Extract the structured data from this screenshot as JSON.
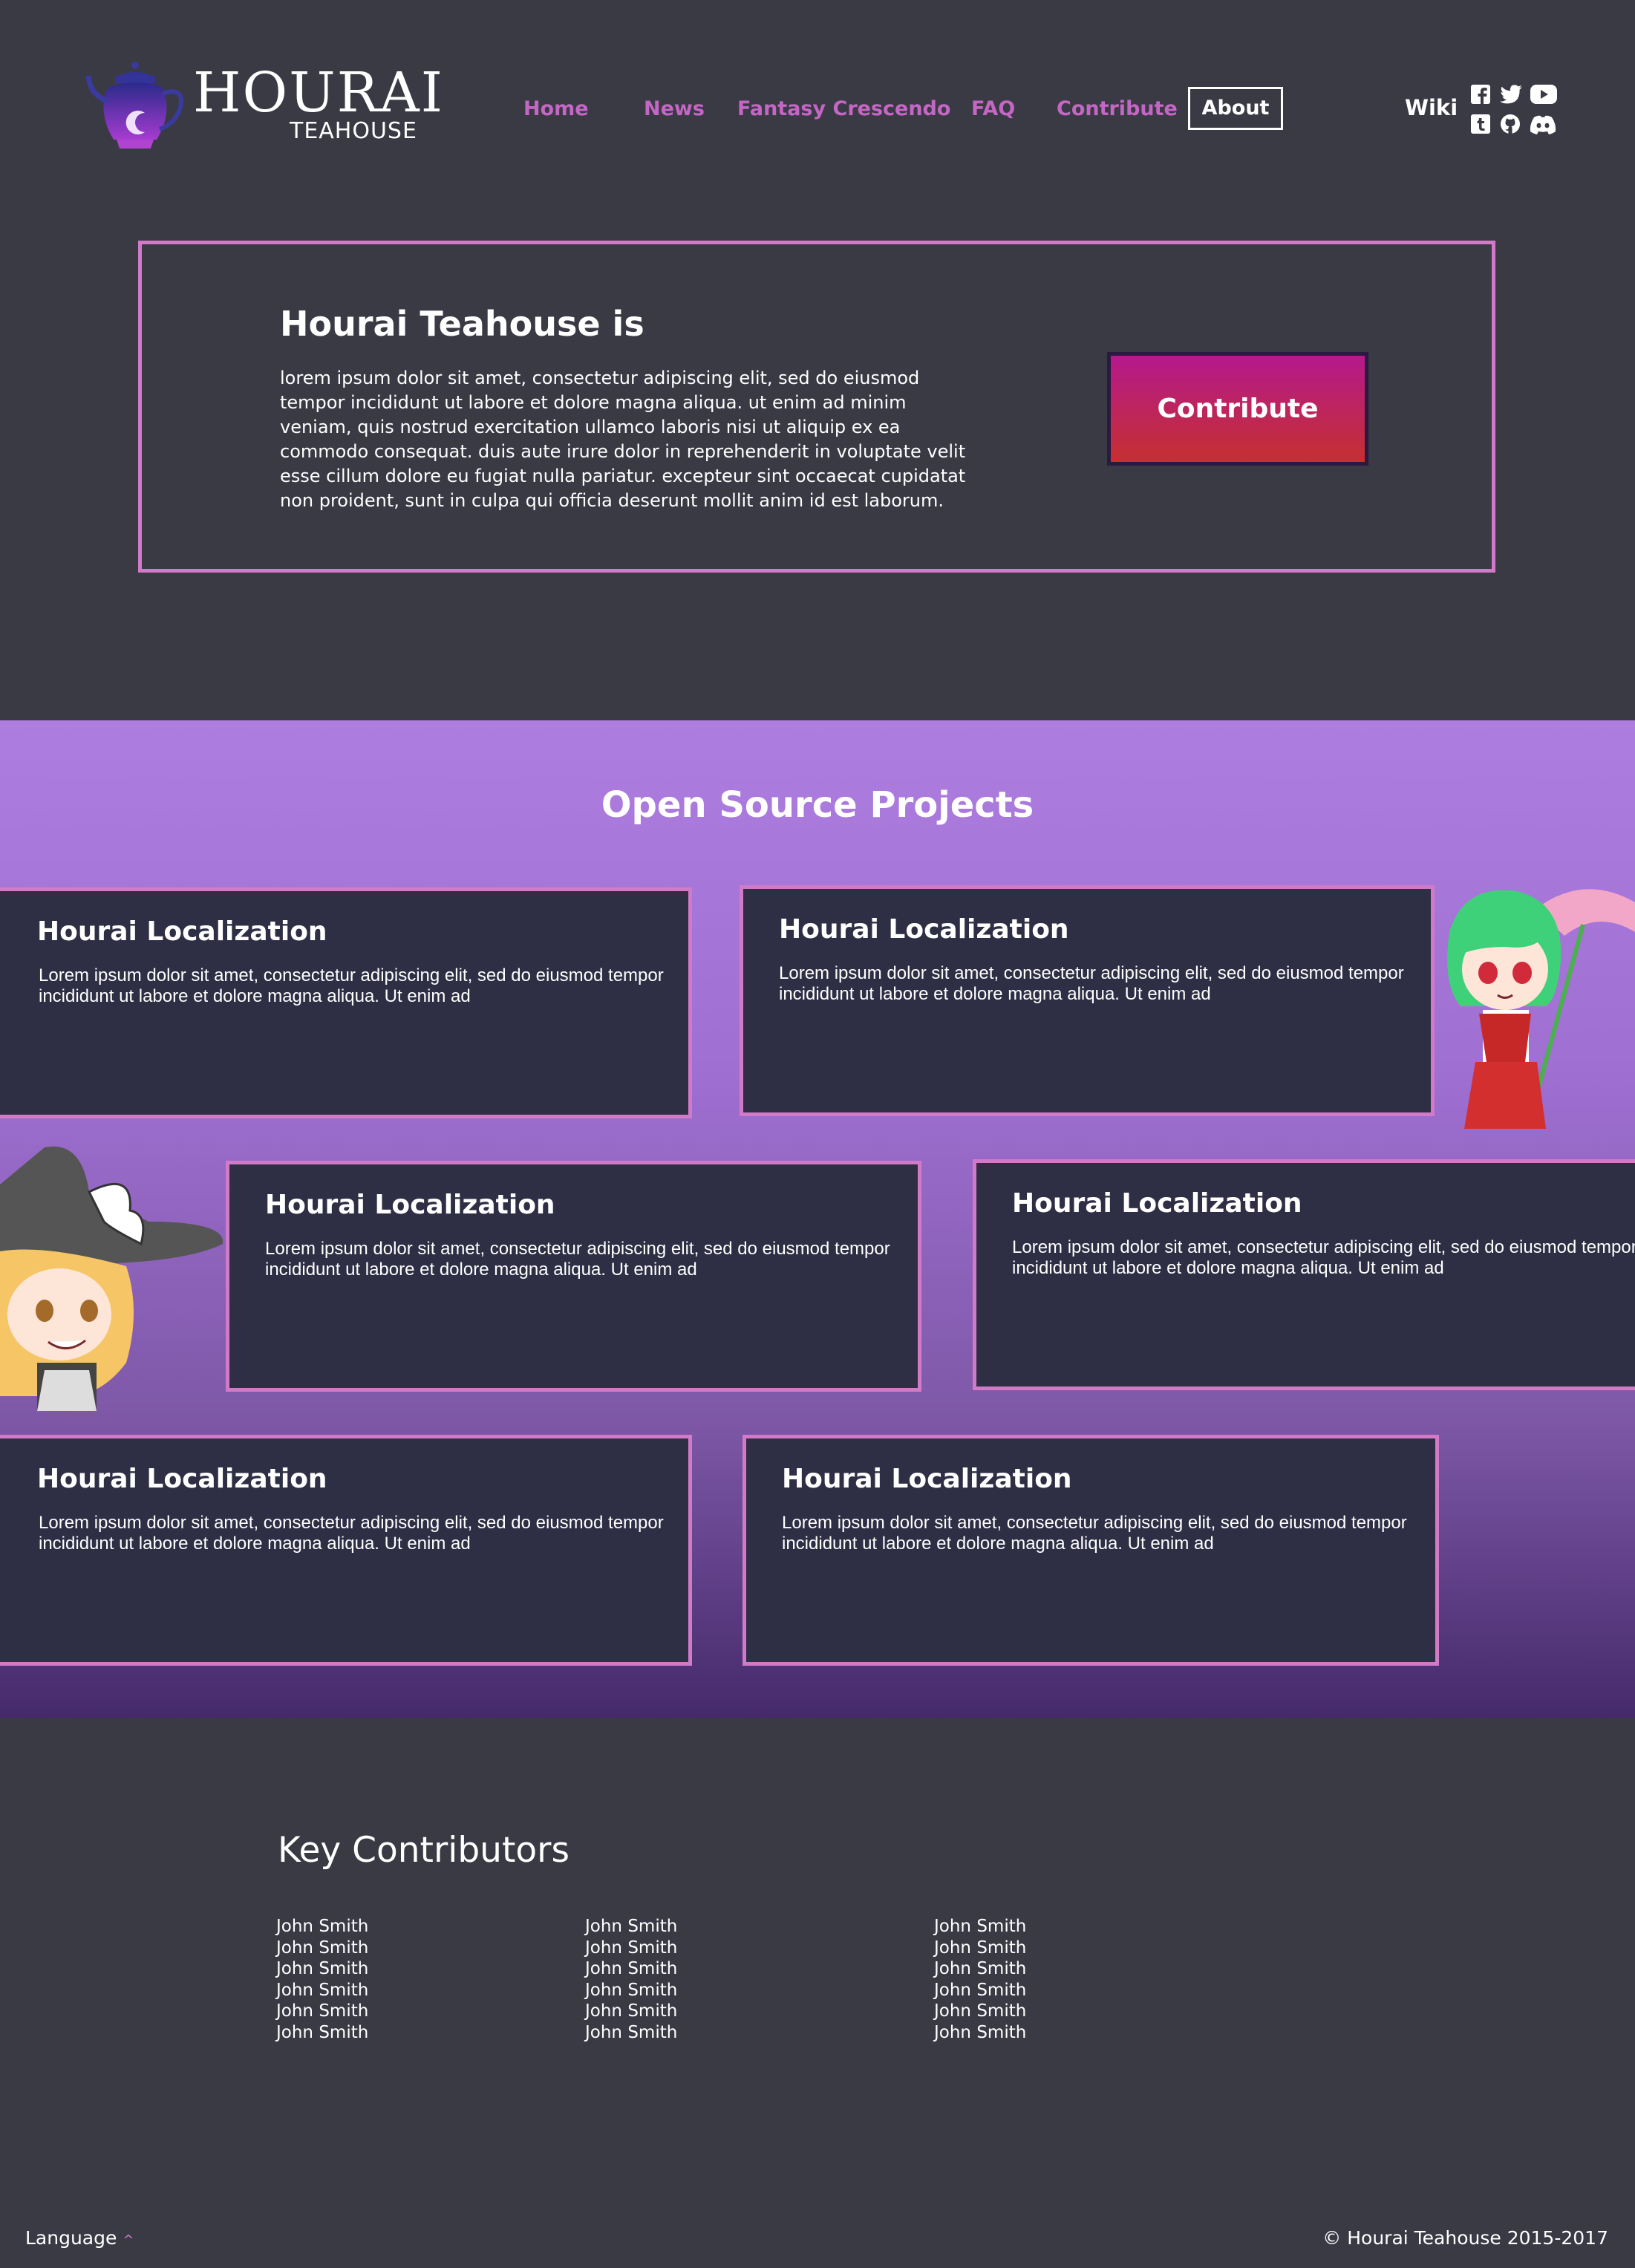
{
  "header": {
    "logo_title": "HOURAI",
    "logo_sub": "TEAHOUSE",
    "nav": [
      {
        "label": "Home"
      },
      {
        "label": "News"
      },
      {
        "label": "Fantasy Crescendo"
      },
      {
        "label": "FAQ"
      },
      {
        "label": "Contribute"
      },
      {
        "label": "About"
      }
    ],
    "wiki_label": "Wiki",
    "social_icons": [
      "facebook-icon",
      "twitter-icon",
      "youtube-icon",
      "tumblr-icon",
      "github-icon",
      "discord-icon"
    ]
  },
  "intro": {
    "heading": "Hourai Teahouse is",
    "text": "lorem ipsum dolor sit amet, consectetur adipiscing elit, sed do eiusmod tempor incididunt ut labore et dolore magna aliqua. ut enim ad minim veniam, quis nostrud exercitation ullamco laboris nisi ut aliquip ex ea commodo consequat. duis aute irure dolor in reprehenderit in voluptate velit esse cillum dolore eu fugiat nulla pariatur. excepteur sint occaecat cupidatat non proident, sunt in culpa qui officia deserunt mollit anim id est laborum.",
    "button_label": "Contribute"
  },
  "projects": {
    "title": "Open Source Projects",
    "cards": [
      {
        "title": "Hourai Localization",
        "text": "Lorem ipsum dolor sit amet, consectetur adipiscing elit, sed do eiusmod tempor incididunt ut labore et dolore magna aliqua. Ut enim ad"
      },
      {
        "title": "Hourai Localization",
        "text": "Lorem ipsum dolor sit amet, consectetur adipiscing elit, sed do eiusmod tempor incididunt ut labore et dolore magna aliqua. Ut enim ad"
      },
      {
        "title": "Hourai Localization",
        "text": "Lorem ipsum dolor sit amet, consectetur adipiscing elit, sed do eiusmod tempor incididunt ut labore et dolore magna aliqua. Ut enim ad"
      },
      {
        "title": "Hourai Localization",
        "text": "Lorem ipsum dolor sit amet, consectetur adipiscing elit, sed do eiusmod tempor incididunt ut labore et dolore magna aliqua. Ut enim ad"
      },
      {
        "title": "Hourai Localization",
        "text": "Lorem ipsum dolor sit amet, consectetur adipiscing elit, sed do eiusmod tempor incididunt ut labore et dolore magna aliqua. Ut enim ad"
      },
      {
        "title": "Hourai Localization",
        "text": "Lorem ipsum dolor sit amet, consectetur adipiscing elit, sed do eiusmod tempor incididunt ut labore et dolore magna aliqua. Ut enim ad"
      }
    ]
  },
  "contributors": {
    "title": "Key Contributors",
    "columns": [
      [
        "John Smith",
        "John Smith",
        "John Smith",
        "John Smith",
        "John Smith",
        "John Smith"
      ],
      [
        "John Smith",
        "John Smith",
        "John Smith",
        "John Smith",
        "John Smith",
        "John Smith"
      ],
      [
        "John Smith",
        "John Smith",
        "John Smith",
        "John Smith",
        "John Smith",
        "John Smith"
      ]
    ]
  },
  "footer": {
    "language_label": "Language",
    "copyright": "© Hourai Teahouse 2015-2017"
  },
  "colors": {
    "background": "#3a3a45",
    "accent": "#d17bc8",
    "nav_link": "#c467c4",
    "card_bg": "#2e2e45",
    "button_top": "#b5198c",
    "button_bottom": "#c53030"
  }
}
